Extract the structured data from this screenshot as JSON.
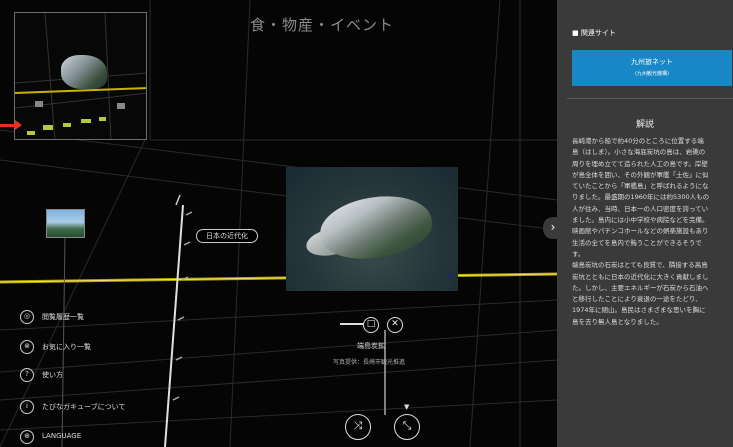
{
  "stage": {
    "category_title": "食・物産・イベント",
    "label_kindai": "日本の近代化",
    "caption_title": "端島炭鉱",
    "caption_sub": "写真提供：長崎市観光推進",
    "square_icon": "□",
    "close_icon": "✕",
    "nav_a_icon": "⤨",
    "nav_b_icon": "⤡",
    "nav_up_icon": "▼",
    "accent_color": "#e8301c",
    "horizon_color": "#c8b400"
  },
  "menu": {
    "items": [
      {
        "icon": "◎",
        "label": "閲覧履歴一覧"
      },
      {
        "icon": "⊗",
        "label": "お気に入り一覧"
      },
      {
        "icon": "?",
        "label": "使い方"
      },
      {
        "icon": "i",
        "label": "たびなガキューブについて"
      },
      {
        "icon": "⊕",
        "label": "LANGUAGE"
      }
    ]
  },
  "panel": {
    "tab_icon": "›",
    "related_heading": "■ 関連サイト",
    "site_button_line1": "九州旅ネット",
    "site_button_line2": "(九州観光機構)",
    "site_button_color": "#1787c6",
    "kaisetsu_title": "解説",
    "description_lines": [
      "長崎港から船で約40分のところに位置する端",
      "島（はしま）。小さな海底炭坑の島は、岩礁の",
      "周りを埋め立てて造られた人工の島です。岸壁",
      "が島全体を囲い、その外観が軍艦「土佐」に似",
      "ていたことから「軍艦島」と呼ばれるようにな",
      "りました。最盛期の1960年には約5300人もの",
      "人が住み、当時、日本一の人口密度を誇ってい",
      "ました。島内には小中学校や病院などを完備。",
      "映画館やパチンコホールなどの娯楽施設もあり",
      "生活の全てを島内で賄うことができるそうで",
      "す。",
      "端島炭坑の石炭はとても良質で、隣接する高島",
      "炭坑とともに日本の近代化に大きく貢献しまし",
      "た。しかし、主要エネルギーが石炭から石油へ",
      "と移行したことにより衰退の一途をたどり、",
      "1974年に閉山。島民はさまざまな思いを胸に",
      "島を去り無人島となりました。"
    ]
  }
}
